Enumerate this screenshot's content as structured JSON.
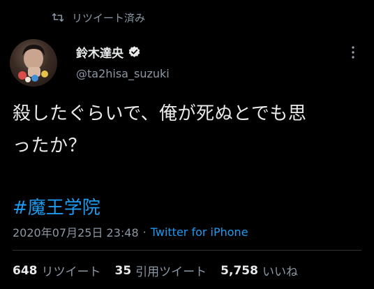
{
  "retweet_header": {
    "label": "リツイート済み",
    "icon": "retweet-icon"
  },
  "author": {
    "display_name": "鈴木達央",
    "handle": "@ta2hisa_suzuki",
    "verified": true,
    "avatar_icon": "user-avatar"
  },
  "tweet": {
    "text_line1": "殺したぐらいで、俺が死ぬとでも思",
    "text_line2": "ったか？",
    "hashtag": "#魔王学院",
    "timestamp": "2020年07月25日 23:48",
    "separator": "·",
    "source": "Twitter for iPhone"
  },
  "stats": {
    "retweets_count": "648",
    "retweets_label": "リツイート",
    "quotes_count": "35",
    "quotes_label": "引用ツイート",
    "likes_count": "5,758",
    "likes_label": "いいね"
  },
  "colors": {
    "background": "#000000",
    "text": "#e7e9ea",
    "secondary": "#8b98a5",
    "link": "#1d9bf0",
    "divider": "#2f3336"
  }
}
